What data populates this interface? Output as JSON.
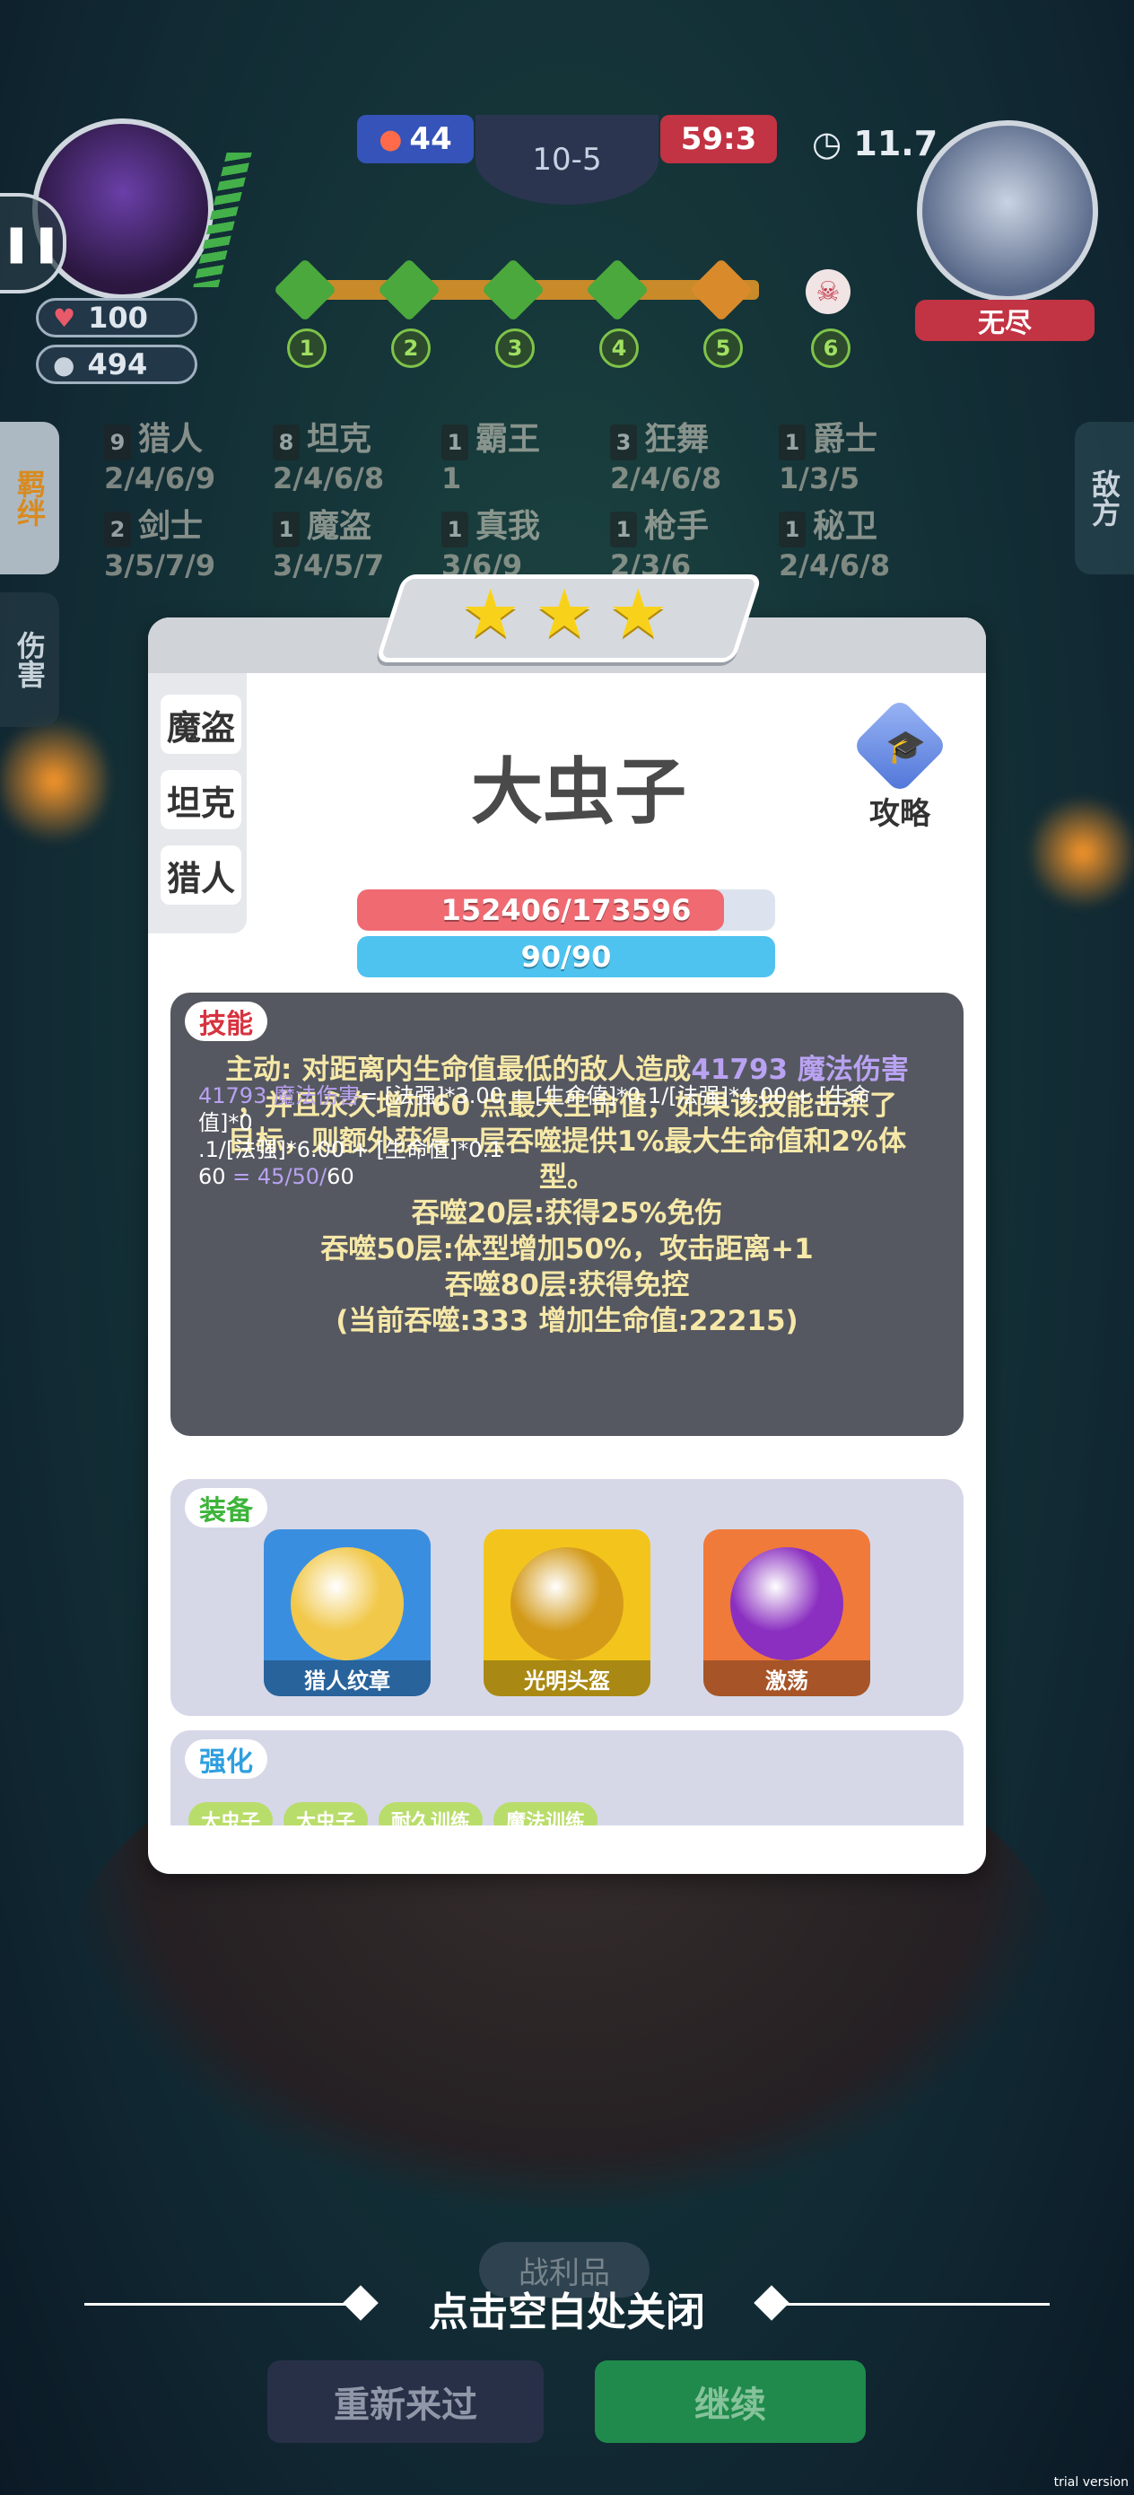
{
  "hud": {
    "player_hp": "100",
    "player_gold": "494",
    "score_blue": "44",
    "score_red": "59:3",
    "round": "10-5",
    "timer": "11.7",
    "enemy_name": "无尽",
    "stages": [
      "1",
      "2",
      "3",
      "4",
      "5",
      "6"
    ],
    "stage_colors": [
      "#4aa83d",
      "#4aa83d",
      "#4aa83d",
      "#4aa83d",
      "#d98a2a"
    ]
  },
  "side_tabs": {
    "bond": "羁绊",
    "damage": "伤害",
    "enemy": "敌方"
  },
  "traits": [
    {
      "count": "9",
      "name": "猎人",
      "levels": "2/4/6/9"
    },
    {
      "count": "8",
      "name": "坦克",
      "levels": "2/4/6/8"
    },
    {
      "count": "1",
      "name": "霸王",
      "levels": "1"
    },
    {
      "count": "3",
      "name": "狂舞",
      "levels": "2/4/6/8"
    },
    {
      "count": "1",
      "name": "爵士",
      "levels": "1/3/5"
    },
    {
      "count": "2",
      "name": "剑士",
      "levels": "3/5/7/9"
    },
    {
      "count": "1",
      "name": "魔盗",
      "levels": "3/4/5/7"
    },
    {
      "count": "1",
      "name": "真我",
      "levels": "3/6/9"
    },
    {
      "count": "1",
      "name": "枪手",
      "levels": "2/3/6"
    },
    {
      "count": "1",
      "name": "秘卫",
      "levels": "2/4/6/8"
    }
  ],
  "unit": {
    "stars": 3,
    "name": "大虫子",
    "guide_label": "攻略",
    "tags": [
      "魔盗",
      "坦克",
      "猎人"
    ],
    "hp_text": "152406/173596",
    "hp_value": 152406,
    "hp_max": 173596,
    "mp_text": "90/90",
    "mp_value": 90,
    "mp_max": 90
  },
  "skill": {
    "label": "技能",
    "line1_a": "主动: 对距离内生命值最低的敌人造成",
    "line1_hi": "41793 魔法伤害",
    "line2": "，并且永久增加60 点最大生命值，如果该技能击杀了",
    "line3": "目标，则额外获得一层吞噬提供1%最大生命值和2%体",
    "line4": "型。",
    "line5": "吞噬20层:获得25%免伤",
    "line6": "吞噬50层:体型增加50%，攻击距离+1",
    "line7": "吞噬80层:获得免控",
    "line8": "(当前吞噬:333 增加生命值:22215)",
    "formula1_hi": "41793 魔法伤害",
    "formula1": "= [法强]*3.00 + [生命值]*0.1/[法强]*4.00 + [生命值]*0",
    "formula2": ".1/[法强]*6.00 + [生命值]*0.1",
    "formula3_a": "60",
    "formula3_b": " = 45/50/",
    "formula3_c": "60"
  },
  "equipment": {
    "label": "装备",
    "items": [
      {
        "name": "猎人纹章",
        "bg": "#3a8ee0",
        "art": "#f1c84a"
      },
      {
        "name": "光明头盔",
        "bg": "#f3c51c",
        "art": "#d39a1a"
      },
      {
        "name": "激荡",
        "bg": "#f07a3a",
        "art": "#8a2fc0"
      }
    ]
  },
  "enhance": {
    "label": "强化",
    "chips": [
      "大虫子",
      "大虫子",
      "耐久训练",
      "魔法训练"
    ]
  },
  "footer": {
    "close_hint": "点击空白处关闭",
    "battle_tag": "战利品",
    "restart": "重新来过",
    "continue": "继续",
    "trial": "trial version"
  }
}
